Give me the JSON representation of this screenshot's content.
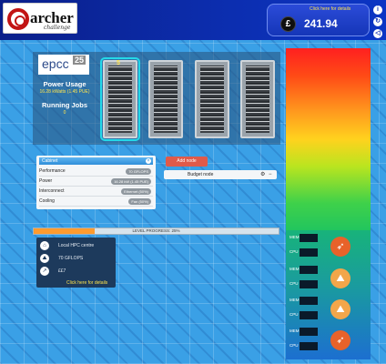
{
  "header": {
    "logo_text": "archer",
    "logo_subtitle": "challenge",
    "budget_link": "Click here for details",
    "currency_symbol": "£",
    "budget_value": "241.94",
    "side_icons": [
      "info-icon",
      "refresh-icon",
      "sound-icon"
    ],
    "side_glyphs": [
      "i",
      "↻",
      "◁"
    ]
  },
  "machine": {
    "epcc_label": "epcc",
    "epcc_number": "25",
    "power_label": "Power Usage",
    "power_value": "16.28 kWatts (1.45 PUE)",
    "jobs_label": "Running Jobs",
    "jobs_value": "0",
    "racks": [
      "rack-1",
      "rack-2",
      "rack-3",
      "rack-4"
    ],
    "selected_rack_tag": "5"
  },
  "detail": {
    "title": "Cabinet",
    "close_glyph": "×",
    "rows": [
      {
        "label": "Performance",
        "value": "70 GFLOPS"
      },
      {
        "label": "Power",
        "value": "16.28 kW (1.45 PUE)"
      },
      {
        "label": "Interconnect",
        "value": "Ethernet (50%)"
      },
      {
        "label": "Cooling",
        "value": "Fan (50%)"
      }
    ]
  },
  "add_node_label": "Add node",
  "budget_node": {
    "label": "Budget node",
    "gear": "⚙",
    "minus": "−"
  },
  "progress": {
    "label": "LEVEL PROGRESS: 25%",
    "fraction": 0.25
  },
  "info": {
    "rows": [
      {
        "icon": "⌂",
        "text": "Local HPC centre"
      },
      {
        "icon": "⛰",
        "text": "70 GFLOPS"
      },
      {
        "icon": "↗",
        "text": "££7"
      }
    ],
    "link": "Click here for details"
  },
  "jobs": [
    {
      "mem": "MEM",
      "cpu": "CPU",
      "icon": "rocket-icon",
      "glyph": "➶",
      "color": "#e8622a"
    },
    {
      "mem": "MEM",
      "cpu": "CPU",
      "icon": "mountain-icon",
      "glyph": "⛰",
      "color": "#f2a64a"
    },
    {
      "mem": "MEM",
      "cpu": "CPU",
      "icon": "mountain-icon",
      "glyph": "⛰",
      "color": "#f2a64a"
    },
    {
      "mem": "MEM",
      "cpu": "CPU",
      "icon": "rocket-icon",
      "glyph": "➶",
      "color": "#e8622a"
    }
  ]
}
